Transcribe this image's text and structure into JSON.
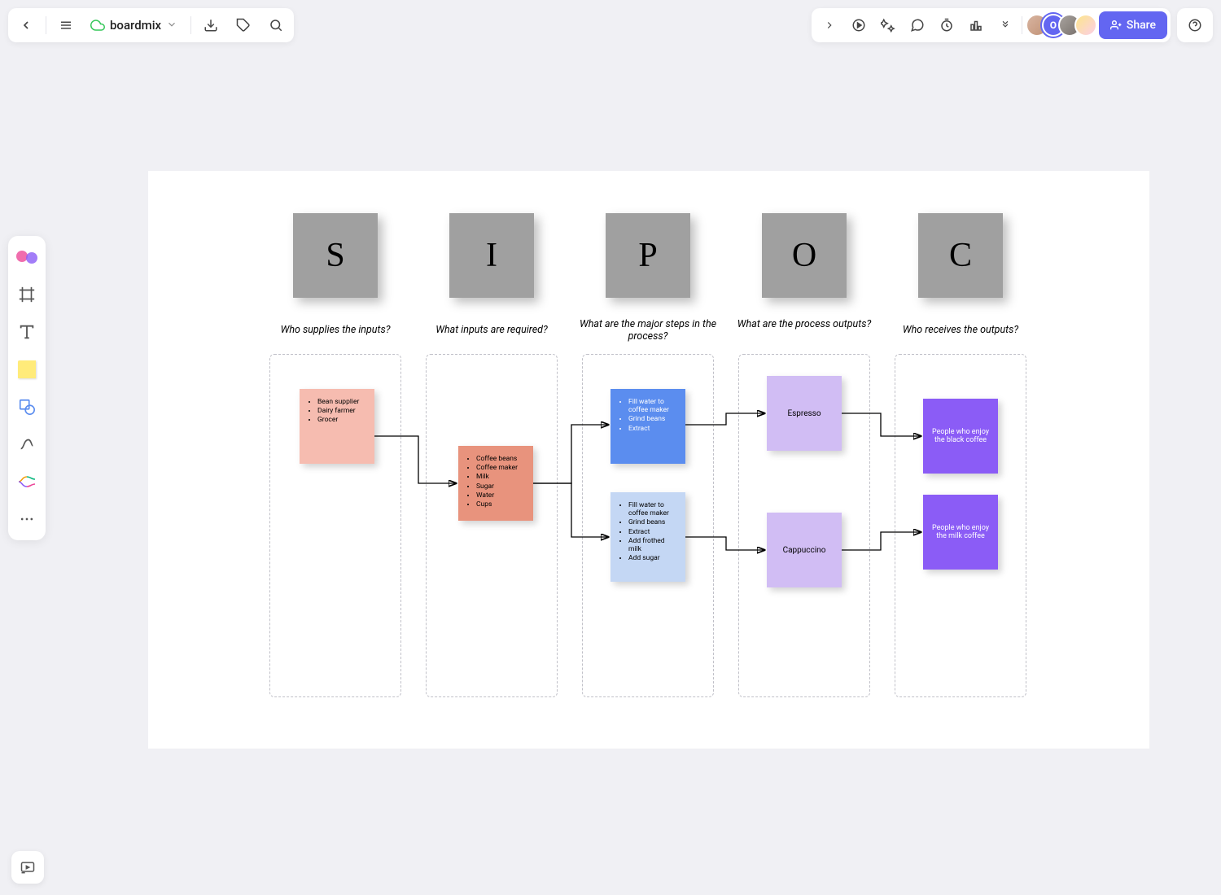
{
  "header": {
    "doc_title": "boardmix",
    "share_label": "Share",
    "avatar_letter": "O"
  },
  "sipoc": {
    "columns": [
      {
        "letter": "S",
        "question": "Who supplies the inputs?"
      },
      {
        "letter": "I",
        "question": "What inputs are required?"
      },
      {
        "letter": "P",
        "question": "What are the major steps in the process?"
      },
      {
        "letter": "O",
        "question": "What are the process outputs?"
      },
      {
        "letter": "C",
        "question": "Who receives the outputs?"
      }
    ],
    "suppliers": [
      "Bean supplier",
      "Dairy farmer",
      "Grocer"
    ],
    "inputs": [
      "Coffee beans",
      "Coffee maker",
      "Milk",
      "Sugar",
      "Water",
      "Cups"
    ],
    "process_a": [
      "Fill water to coffee maker",
      "Grind beans",
      "Extract"
    ],
    "process_b": [
      "Fill water to coffee maker",
      "Grind beans",
      "Extract",
      "Add frothed milk",
      "Add sugar"
    ],
    "output_a": "Espresso",
    "output_b": "Cappuccino",
    "customer_a": "People who enjoy the black coffee",
    "customer_b": "People who enjoy the milk coffee"
  }
}
